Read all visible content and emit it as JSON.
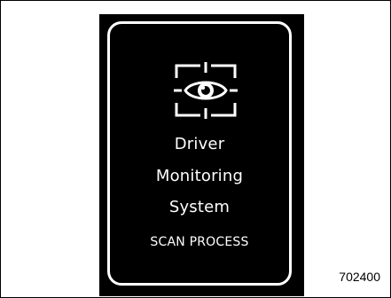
{
  "display": {
    "icon": "eye-scan-icon",
    "title_lines": [
      "Driver",
      "Monitoring",
      "System"
    ],
    "status": "SCAN PROCESS"
  },
  "figure": {
    "code": "702400"
  },
  "colors": {
    "screen_background": "#000000",
    "screen_foreground": "#ffffff",
    "page_background": "#ffffff"
  }
}
